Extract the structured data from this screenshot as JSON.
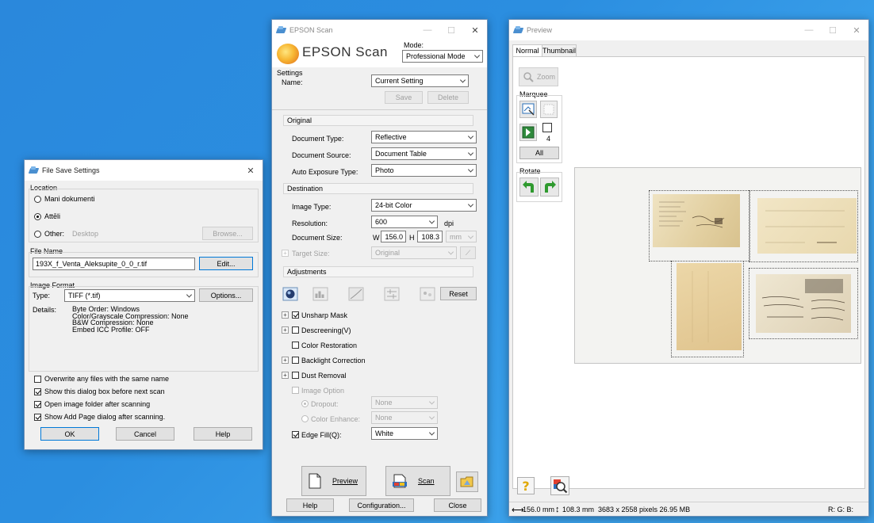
{
  "file_save": {
    "title": "File Save Settings",
    "location_label": "Location",
    "opt_mani": "Mani dokumenti",
    "opt_attels": "Attēli",
    "opt_other": "Other:",
    "other_path": "Desktop",
    "browse": "Browse...",
    "file_name_label": "File Name",
    "file_name_value": "193X_f_Venta_Aleksupite_0_0_r.tif",
    "edit": "Edit...",
    "image_format_label": "Image Format",
    "type_label": "Type:",
    "type_value": "TIFF (*.tif)",
    "options": "Options...",
    "details_label": "Details:",
    "details": [
      "Byte Order: Windows",
      "Color/Grayscale Compression: None",
      "B&W Compression: None",
      "Embed ICC Profile: OFF"
    ],
    "chk_overwrite": "Overwrite any files with the same name",
    "chk_show_dialog": "Show this dialog box before next scan",
    "chk_open_folder": "Open image folder after scanning",
    "chk_add_page": "Show Add Page dialog after scanning.",
    "ok": "OK",
    "cancel": "Cancel",
    "help": "Help"
  },
  "epson": {
    "title": "EPSON Scan",
    "logo_text": "EPSON Scan",
    "mode_label": "Mode:",
    "mode_value": "Professional Mode",
    "settings_label": "Settings",
    "name_label": "Name:",
    "name_value": "Current Setting",
    "save": "Save",
    "delete": "Delete",
    "original_hdr": "Original",
    "doc_type_label": "Document Type:",
    "doc_type_value": "Reflective",
    "doc_source_label": "Document Source:",
    "doc_source_value": "Document Table",
    "auto_exp_label": "Auto Exposure Type:",
    "auto_exp_value": "Photo",
    "destination_hdr": "Destination",
    "image_type_label": "Image Type:",
    "image_type_value": "24-bit Color",
    "resolution_label": "Resolution:",
    "resolution_value": "600",
    "dpi": "dpi",
    "doc_size_label": "Document Size:",
    "w_label": "W",
    "w_value": "156.0",
    "h_label": "H",
    "h_value": "108.3",
    "unit_value": "mm",
    "target_size_label": "Target Size:",
    "target_size_value": "Original",
    "adjustments_hdr": "Adjustments",
    "reset": "Reset",
    "unsharp": "Unsharp Mask",
    "descreening": "Descreening(V)",
    "color_restoration": "Color Restoration",
    "backlight": "Backlight Correction",
    "dust": "Dust Removal",
    "image_option": "Image Option",
    "dropout": "Dropout:",
    "dropout_value": "None",
    "color_enhance": "Color Enhance:",
    "color_enhance_value": "None",
    "edge_fill": "Edge Fill(Q):",
    "edge_fill_value": "White",
    "preview_btn": "Preview",
    "scan_btn": "Scan",
    "help": "Help",
    "configuration": "Configuration...",
    "close": "Close"
  },
  "preview": {
    "title": "Preview",
    "tab_normal": "Normal",
    "tab_thumbnail": "Thumbnail",
    "zoom": "Zoom",
    "marquee_label": "Marquee",
    "marquee_count": "4",
    "all": "All",
    "rotate_label": "Rotate",
    "status_w": "156.0 mm",
    "status_h": "108.3 mm",
    "status_pixels": "3683 x 2558 pixels 26.95 MB",
    "status_rgb": "R: G: B:"
  },
  "colors": {
    "desktop": "#2b8ee0",
    "window_bg": "#f0f0f0",
    "accent": "#0078d7",
    "rotate_green": "#2f9a2f",
    "paper": "#e8d9b4"
  }
}
